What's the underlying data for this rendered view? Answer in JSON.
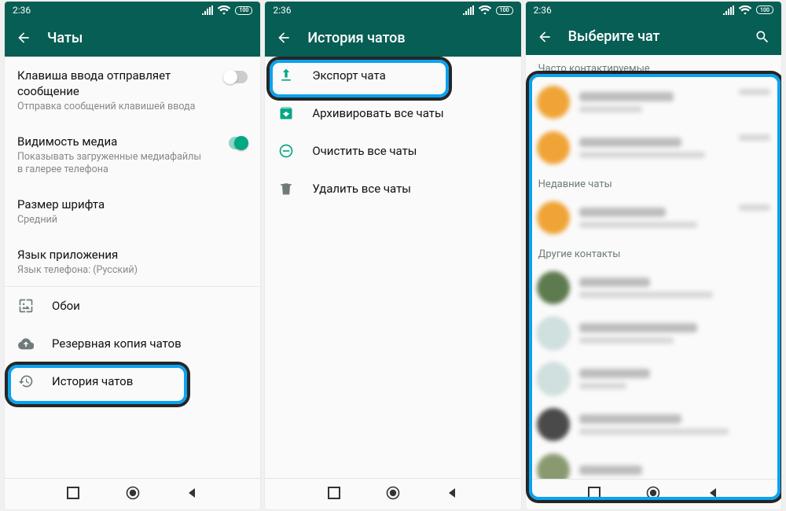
{
  "status": {
    "time": "2:36",
    "battery": "100"
  },
  "screen1": {
    "title": "Чаты",
    "items": {
      "enter_send": {
        "label": "Клавиша ввода отправляет сообщение",
        "sub": "Отправка сообщений клавишей ввода"
      },
      "media_visibility": {
        "label": "Видимость медиа",
        "sub": "Показывать загруженные медиафайлы в галерее телефона"
      },
      "font_size": {
        "label": "Размер шрифта",
        "sub": "Средний"
      },
      "app_lang": {
        "label": "Язык приложения",
        "sub": "Язык телефона: (Русский)"
      },
      "wallpaper": {
        "label": "Обои"
      },
      "backup": {
        "label": "Резервная копия чатов"
      },
      "history": {
        "label": "История чатов"
      }
    }
  },
  "screen2": {
    "title": "История чатов",
    "items": {
      "export": {
        "label": "Экспорт чата"
      },
      "archive": {
        "label": "Архивировать все чаты"
      },
      "clear": {
        "label": "Очистить все чаты"
      },
      "delete": {
        "label": "Удалить все чаты"
      }
    }
  },
  "screen3": {
    "title": "Выберите чат",
    "sections": {
      "frequent": "Часто контактируемые",
      "recent": "Недавние чаты",
      "others": "Другие контакты"
    }
  }
}
